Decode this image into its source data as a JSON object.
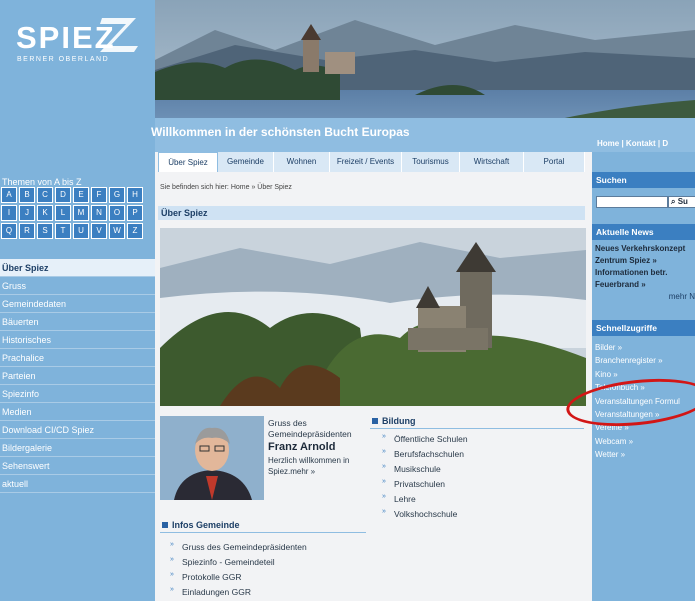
{
  "brand": {
    "name": "SPIEZ",
    "region": "BERNER OBERLAND"
  },
  "header": {
    "welcome": "Willkommen in der schönsten Bucht Europas",
    "toplinks": "Home | Kontakt | D"
  },
  "tabs": [
    "Über Spiez",
    "Gemeinde",
    "Wohnen",
    "Freizeit / Events",
    "Tourismus",
    "Wirtschaft",
    "Portal"
  ],
  "az": {
    "title": "Themen von A bis Z",
    "letters": [
      "A",
      "B",
      "C",
      "D",
      "E",
      "F",
      "G",
      "H",
      "I",
      "J",
      "K",
      "L",
      "M",
      "N",
      "O",
      "P",
      "Q",
      "R",
      "S",
      "T",
      "U",
      "V",
      "W",
      "Z"
    ]
  },
  "leftnav": [
    "Über Spiez",
    "Gruss",
    "Gemeindedaten",
    "Bäuerten",
    "Historisches",
    "Prachalice",
    "Parteien",
    "Spiezinfo",
    "Medien",
    "Download CI/CD Spiez",
    "Bildergalerie",
    "Sehenswert",
    "aktuell"
  ],
  "breadcrumb": "Sie befinden sich hier: Home » Über Spiez",
  "page_title": "Über Spiez",
  "greeting": {
    "heading": "Gruss des Gemeindepräsidenten",
    "name": "Franz Arnold",
    "text": "Herzlich willkommen in Spiez.mehr »"
  },
  "bildung": {
    "title": "Bildung",
    "items": [
      "Öffentliche Schulen",
      "Berufsfachschulen",
      "Musikschule",
      "Privatschulen",
      "Lehre",
      "Volkshochschule"
    ]
  },
  "infos": {
    "title": "Infos Gemeinde",
    "items": [
      "Gruss des Gemeindepräsidenten",
      "Spiezinfo - Gemeindeteil",
      "Protokolle GGR",
      "Einladungen GGR"
    ]
  },
  "sidebar_right": {
    "search_title": "Suchen",
    "search_button": "Su",
    "news_title": "Aktuelle News",
    "news": [
      "Neues Verkehrskonzept",
      "Zentrum Spiez »",
      "Informationen betr.",
      "Feuerbrand »"
    ],
    "news_more": "mehr N",
    "quick_title": "Schnellzugriffe",
    "quick": [
      "Bilder »",
      "Branchenregister »",
      "Kino »",
      "Telefonbuch »",
      "Veranstaltungen Formul",
      "Veranstaltungen »",
      "Vereine »",
      "Webcam »",
      "Wetter »"
    ]
  }
}
